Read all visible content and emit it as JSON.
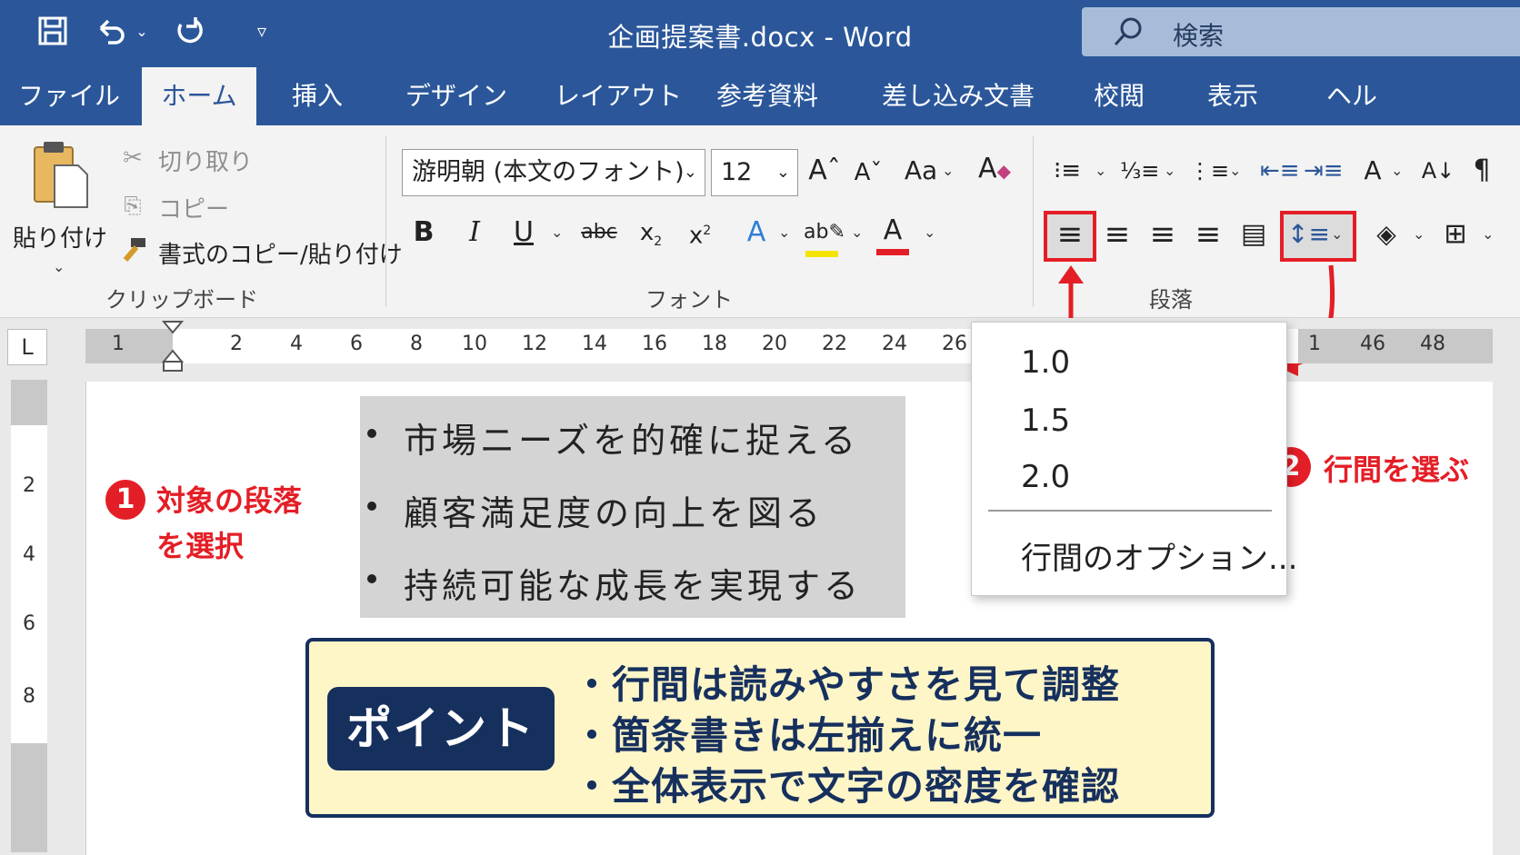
{
  "window": {
    "title": "企画提案書.docx  -  Word",
    "search_placeholder": "検索"
  },
  "quick_access": {
    "save_icon": "save-icon",
    "undo_icon": "undo-icon",
    "redo_icon": "redo-icon",
    "customize_icon": "customize-qat-icon"
  },
  "tabs": [
    {
      "label": "ファイル"
    },
    {
      "label": "ホーム",
      "active": true
    },
    {
      "label": "挿入"
    },
    {
      "label": "デザイン"
    },
    {
      "label": "レイアウト"
    },
    {
      "label": "参考資料"
    },
    {
      "label": "差し込み文書"
    },
    {
      "label": "校閲"
    },
    {
      "label": "表示"
    },
    {
      "label": "ヘルプ"
    }
  ],
  "clipboard": {
    "paste_label": "貼り付け",
    "cut_label": "切り取り",
    "copy_label": "コピー",
    "format_painter_label": "書式のコピー/貼り付け",
    "group_label": "クリップボード"
  },
  "font": {
    "font_name": "游明朝 (本文のフォント)",
    "font_size": "12",
    "group_label": "フォント",
    "change_case_label": "Aa",
    "font_color": "#e41e26",
    "highlight_color": "#f5e400"
  },
  "paragraph": {
    "group_label": "段落",
    "pilcrow": "¶"
  },
  "ruler": {
    "corner": "L",
    "ticks": [
      "1",
      "2",
      "4",
      "6",
      "8",
      "10",
      "12",
      "14",
      "16",
      "18",
      "20",
      "22",
      "24",
      "26",
      "1",
      "46",
      "48"
    ],
    "vticks": [
      "2",
      "4",
      "6",
      "8"
    ]
  },
  "document": {
    "bullets": [
      "市場ニーズを的確に捉える",
      "顧客満足度の向上を図る",
      "持続可能な成長を実現する"
    ]
  },
  "line_spacing_menu": {
    "options": [
      "1.0",
      "1.5",
      "2.0"
    ],
    "more_options": "行間のオプション..."
  },
  "annotations": {
    "step1_number": "1",
    "step1_line1": "対象の段落",
    "step1_line2": "を選択",
    "step2_number": "2",
    "step2_text": "行間を選ぶ",
    "accent_color": "#e41e26"
  },
  "point_box": {
    "label": "ポイント",
    "lines": [
      "・行間は読みやすさを見て調整",
      "・箇条書きは左揃えに統一",
      "・全体表示で文字の密度を確認"
    ],
    "navy": "#16305e",
    "background": "#fff6c8"
  }
}
